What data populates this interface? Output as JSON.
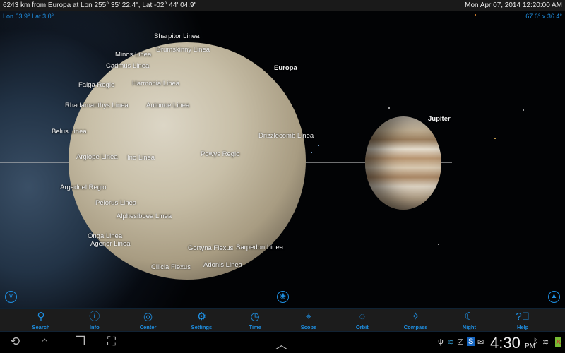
{
  "status": {
    "location": "6243 km from Europa at Lon 255° 35' 22.4\", Lat -02° 44' 04.9\"",
    "datetime": "Mon Apr 07, 2014  12:20:00 AM"
  },
  "view": {
    "lonlat": "Lon 63.9° Lat 3.0°",
    "fov": "67.6° x 36.4°"
  },
  "labels": [
    "Sharpitor Linea",
    "Drumskinny Linea",
    "Minos Linea",
    "Cadmus Linea",
    "Europa",
    "Falga Regio",
    "Harmonia Linea",
    "Rhadamanthys Linea",
    "Autonoe Linea",
    "Belus Linea",
    "Drizzlecomb Linea",
    "Powys Regio",
    "Argiope Linea",
    "Ino Linea",
    "Argadnel Regio",
    "Pelorus Linea",
    "Alphesiboea Linea",
    "Onga Linea",
    "Agenor Linea",
    "Gortyna Flexus",
    "Sarpedon Linea",
    "Cilicia Flexus",
    "Adonis Linea",
    "Jupiter"
  ],
  "toolbar": [
    {
      "label": "Search",
      "icon": "search-icon"
    },
    {
      "label": "Info",
      "icon": "info-icon"
    },
    {
      "label": "Center",
      "icon": "target-icon"
    },
    {
      "label": "Settings",
      "icon": "gear-icon"
    },
    {
      "label": "Time",
      "icon": "clock-icon"
    },
    {
      "label": "Scope",
      "icon": "telescope-icon"
    },
    {
      "label": "Orbit",
      "icon": "orbit-icon"
    },
    {
      "label": "Compass",
      "icon": "compass-icon"
    },
    {
      "label": "Night",
      "icon": "moon-icon"
    },
    {
      "label": "Help",
      "icon": "help-icon"
    }
  ],
  "system": {
    "time": "4:30",
    "ampm": "PM"
  },
  "colors": {
    "accent": "#1e8ee0"
  }
}
